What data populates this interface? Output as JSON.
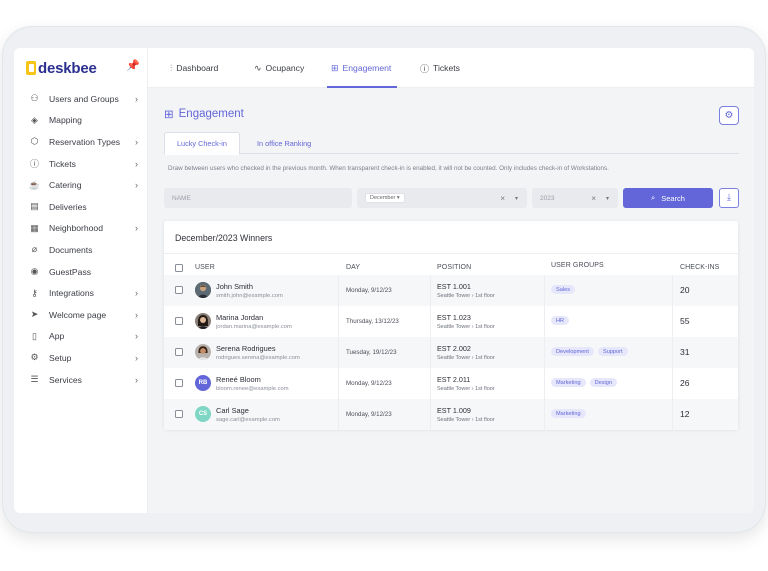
{
  "brand": {
    "name": "deskbee"
  },
  "sidebar": {
    "items": [
      {
        "label": "Users and Groups",
        "icon": "users-icon",
        "chevron": true
      },
      {
        "label": "Mapping",
        "icon": "layers-icon",
        "chevron": false
      },
      {
        "label": "Reservation Types",
        "icon": "box-icon",
        "chevron": true
      },
      {
        "label": "Tickets",
        "icon": "alert-circle-icon",
        "chevron": true
      },
      {
        "label": "Catering",
        "icon": "coffee-icon",
        "chevron": true
      },
      {
        "label": "Deliveries",
        "icon": "archive-icon",
        "chevron": false
      },
      {
        "label": "Neighborhood",
        "icon": "grid-icon",
        "chevron": true
      },
      {
        "label": "Documents",
        "icon": "paperclip-icon",
        "chevron": false
      },
      {
        "label": "GuestPass",
        "icon": "map-pin-icon",
        "chevron": false
      },
      {
        "label": "Integrations",
        "icon": "key-icon",
        "chevron": true
      },
      {
        "label": "Welcome page",
        "icon": "send-icon",
        "chevron": true
      },
      {
        "label": "App",
        "icon": "smartphone-icon",
        "chevron": true
      },
      {
        "label": "Setup",
        "icon": "gear-icon",
        "chevron": true
      },
      {
        "label": "Services",
        "icon": "server-icon",
        "chevron": true
      }
    ]
  },
  "topnav": {
    "tabs": [
      {
        "label": "Dashboard",
        "icon": "bar-chart-icon"
      },
      {
        "label": "Ocupancy",
        "icon": "activity-icon"
      },
      {
        "label": "Engagement",
        "icon": "gift-icon"
      },
      {
        "label": "Tickets",
        "icon": "alert-circle-icon"
      }
    ],
    "active": "Engagement"
  },
  "page": {
    "title": "Engagement",
    "subtabs": [
      "Lucky Check-in",
      "In office Ranking"
    ],
    "active_subtab": "Lucky Check-in",
    "description": "Draw between users who checked in the previous month. When transparent check-in is enabled, it will not be counted. Only includes check-in of Workstations."
  },
  "filters": {
    "name_placeholder": "NAME",
    "month": "December",
    "year": "2023",
    "search_label": "Search",
    "clear_symbol": "×",
    "caret_symbol": "▾"
  },
  "winners": {
    "title": "December/2023 Winners",
    "headers": [
      "USER",
      "DAY",
      "POSITION",
      "USER GROUPS",
      "CHECK-INS"
    ],
    "rows": [
      {
        "name": "John Smith",
        "email": "smith.john@example.com",
        "initials": "",
        "day": "Monday, 9/12/23",
        "position": "EST 1.001",
        "location": "Seattle Tower › 1st floor",
        "groups": [
          "Sales"
        ],
        "checkins": "20"
      },
      {
        "name": "Marina Jordan",
        "email": "jordan.marina@example.com",
        "initials": "",
        "day": "Thursday, 13/12/23",
        "position": "EST 1.023",
        "location": "Seattle Tower › 1st floor",
        "groups": [
          "HR"
        ],
        "checkins": "55"
      },
      {
        "name": "Serena Rodrigues",
        "email": "rodrigues.serena@example.com",
        "initials": "",
        "day": "Tuesday, 19/12/23",
        "position": "EST 2.002",
        "location": "Seattle Tower › 1st floor",
        "groups": [
          "Development",
          "Support"
        ],
        "checkins": "31"
      },
      {
        "name": "Reneé Bloom",
        "email": "bloom.renee@example.com",
        "initials": "RB",
        "day": "Monday, 9/12/23",
        "position": "EST 2.011",
        "location": "Seattle Tower › 1st floor",
        "groups": [
          "Marketing",
          "Design"
        ],
        "checkins": "26"
      },
      {
        "name": "Carl Sage",
        "email": "sage.carl@example.com",
        "initials": "CS",
        "day": "Monday, 9/12/23",
        "position": "EST 1.009",
        "location": "Seattle Tower › 1st floor",
        "groups": [
          "Marketing"
        ],
        "checkins": "12"
      }
    ]
  },
  "colors": {
    "accent": "#6266d8",
    "brand_yellow": "#f7c518",
    "brand_navy": "#2b2f8f"
  }
}
